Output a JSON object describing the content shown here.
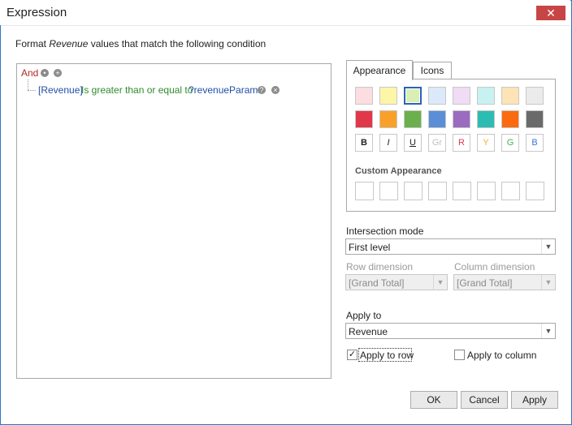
{
  "window": {
    "title": "Expression",
    "close_glyph": "✕"
  },
  "header": {
    "prefix": "Format ",
    "field": "Revenue",
    "suffix": " values that match the following condition"
  },
  "condition_tree": {
    "root_label": "And",
    "root_icons": [
      "ellipsis-icon",
      "add-icon"
    ],
    "items": [
      {
        "field": "[Revenue]",
        "operator": "Is greater than or equal to",
        "value": "?revenueParam1",
        "icons": [
          "help-icon",
          "remove-icon"
        ]
      }
    ]
  },
  "tabs": [
    {
      "label": "Appearance",
      "active": true
    },
    {
      "label": "Icons",
      "active": false
    }
  ],
  "appearance": {
    "light_colors": [
      "#fcdde1",
      "#fdf5a8",
      "#d9efb4",
      "#dbe9fb",
      "#f0dcf5",
      "#c8f1f1",
      "#fde3b5",
      "#ebebeb"
    ],
    "selected_light_index": 2,
    "dark_colors": [
      "#e0384a",
      "#f9a028",
      "#6ab04c",
      "#5a8fd8",
      "#9b6bbf",
      "#2dbcb4",
      "#fb6a0f",
      "#6a6a6a"
    ],
    "font_buttons": [
      {
        "label": "B",
        "color": "#222222",
        "style": "bold"
      },
      {
        "label": "I",
        "color": "#222222",
        "style": "italic"
      },
      {
        "label": "U",
        "color": "#222222",
        "style": "underline"
      },
      {
        "label": "Gr",
        "color": "#c0c0c0",
        "style": "normal"
      },
      {
        "label": "R",
        "color": "#e0384a",
        "style": "normal"
      },
      {
        "label": "Y",
        "color": "#f0b030",
        "style": "normal"
      },
      {
        "label": "G",
        "color": "#4caf50",
        "style": "normal"
      },
      {
        "label": "B",
        "color": "#3a78d4",
        "style": "normal"
      }
    ],
    "custom_label": "Custom Appearance",
    "custom_count": 8
  },
  "intersection": {
    "label": "Intersection mode",
    "value": "First level"
  },
  "row_dimension": {
    "label": "Row dimension",
    "value": "[Grand Total]",
    "disabled": true
  },
  "column_dimension": {
    "label": "Column dimension",
    "value": "[Grand Total]",
    "disabled": true
  },
  "apply_to": {
    "label": "Apply to",
    "value": "Revenue"
  },
  "checkboxes": {
    "apply_to_row": {
      "label": "Apply to row",
      "checked": true
    },
    "apply_to_column": {
      "label": "Apply to column",
      "checked": false
    }
  },
  "buttons": {
    "ok": "OK",
    "cancel": "Cancel",
    "apply": "Apply"
  },
  "glyphs": {
    "dropdown_arrow": "▼",
    "check": "✓"
  }
}
